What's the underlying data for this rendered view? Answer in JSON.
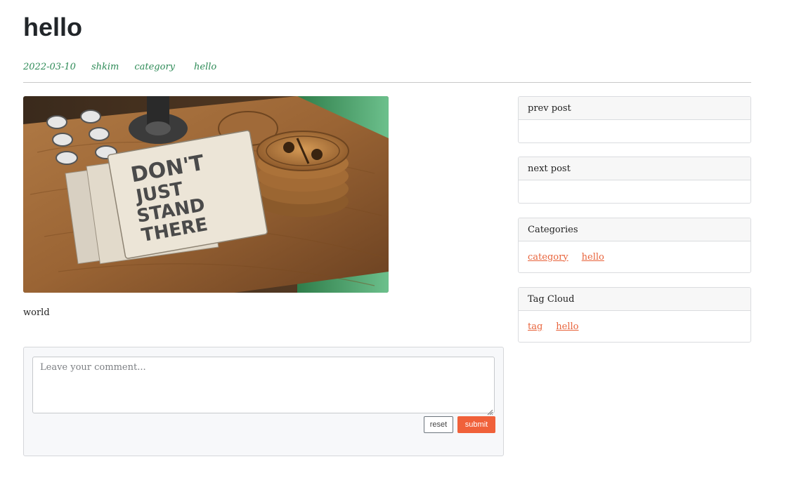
{
  "post": {
    "title": "hello",
    "meta": {
      "date": "2022-03-10",
      "author": "shkim",
      "category": "category",
      "tag": "hello"
    },
    "body": "world"
  },
  "comment": {
    "placeholder": "Leave your comment...",
    "reset_label": "reset",
    "submit_label": "submit"
  },
  "sidebar": {
    "prev": {
      "title": "prev post"
    },
    "next": {
      "title": "next post"
    },
    "categories": {
      "title": "Categories",
      "items": [
        "category",
        "hello"
      ]
    },
    "tags": {
      "title": "Tag Cloud",
      "items": [
        "tag",
        "hello"
      ]
    }
  },
  "colors": {
    "meta_green": "#2e8b57",
    "accent": "#f0613a",
    "link": "#e8643c"
  },
  "icons": {
    "resize": "resize-grip-icon"
  }
}
